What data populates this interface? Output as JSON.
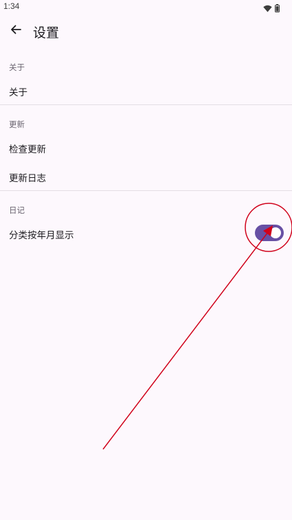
{
  "status_bar": {
    "time": "1:34"
  },
  "app_bar": {
    "title": "设置"
  },
  "sections": {
    "about": {
      "header": "关于",
      "items": [
        {
          "label": "关于"
        }
      ]
    },
    "update": {
      "header": "更新",
      "items": [
        {
          "label": "检查更新"
        },
        {
          "label": "更新日志"
        }
      ]
    },
    "diary": {
      "header": "日记",
      "items": [
        {
          "label": "分类按年月显示",
          "toggle_on": true
        }
      ]
    }
  },
  "colors": {
    "background": "#fdf8fd",
    "switch_on": "#6750a4",
    "annotation": "#d0021b"
  },
  "icons": [
    "wifi-icon",
    "battery-icon",
    "back-arrow-icon"
  ]
}
